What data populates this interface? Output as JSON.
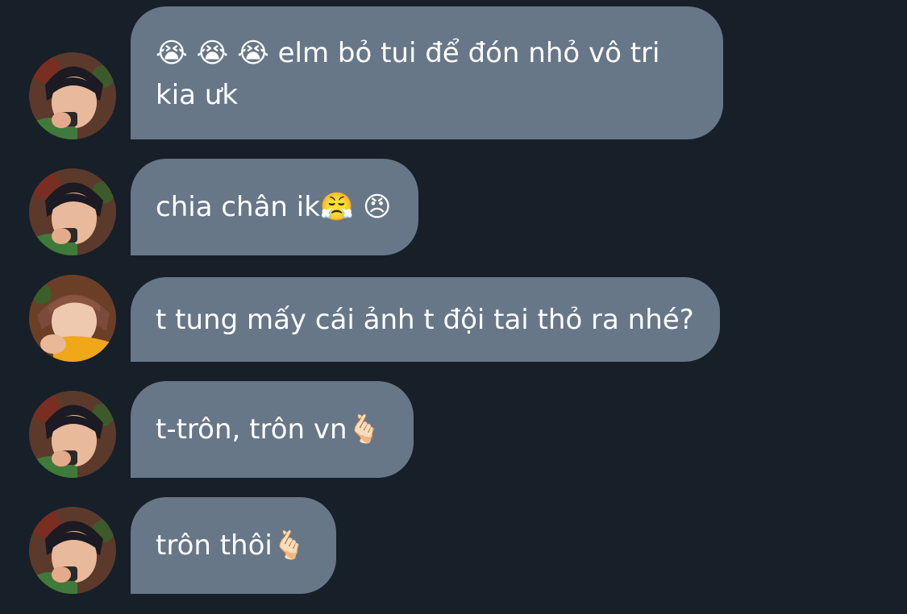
{
  "colors": {
    "background": "#171f29",
    "bubble": "#677788",
    "text": "#ffffff"
  },
  "messages": [
    {
      "sender": "user-a",
      "avatar": "avatar-boy-icon",
      "lines": [
        "😭 😭 😭  elm bỏ tui để đón nhỏ vô tri",
        "kia ưk"
      ]
    },
    {
      "sender": "user-a",
      "avatar": "avatar-boy-icon",
      "lines": [
        "chia chân ik😤 😠"
      ]
    },
    {
      "sender": "user-b",
      "avatar": "avatar-girl-icon",
      "lines": [
        "t tung mấy cái ảnh t đội tai thỏ ra nhé?"
      ]
    },
    {
      "sender": "user-a",
      "avatar": "avatar-boy-icon",
      "lines": [
        "t-trôn, trôn vn🫰🏻"
      ]
    },
    {
      "sender": "user-a",
      "avatar": "avatar-boy-icon",
      "lines": [
        "trôn thôi🫰🏻"
      ]
    }
  ]
}
